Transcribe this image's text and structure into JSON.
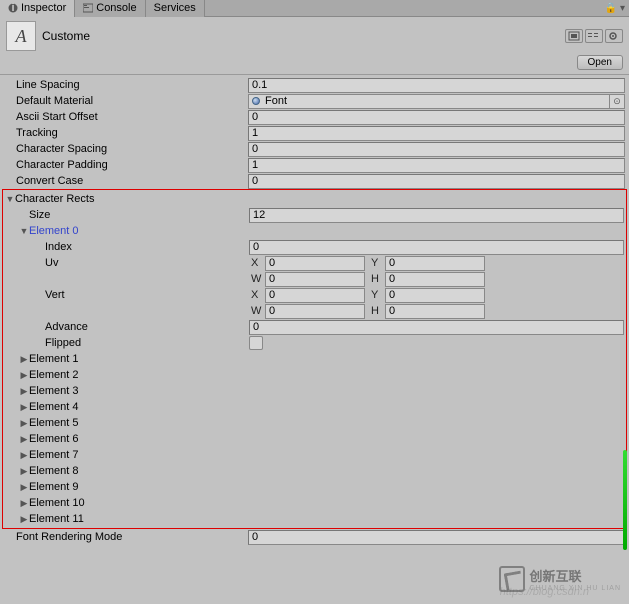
{
  "tabs": {
    "inspector": "Inspector",
    "console": "Console",
    "services": "Services"
  },
  "header": {
    "name": "Custome",
    "open": "Open"
  },
  "props": {
    "line_spacing": {
      "label": "Line Spacing",
      "value": "0.1"
    },
    "default_material": {
      "label": "Default Material",
      "value": "Font"
    },
    "ascii_start_offset": {
      "label": "Ascii Start Offset",
      "value": "0"
    },
    "tracking": {
      "label": "Tracking",
      "value": "1"
    },
    "character_spacing": {
      "label": "Character Spacing",
      "value": "0"
    },
    "character_padding": {
      "label": "Character Padding",
      "value": "1"
    },
    "convert_case": {
      "label": "Convert Case",
      "value": "0"
    }
  },
  "char_rects": {
    "label": "Character Rects",
    "size_label": "Size",
    "size_value": "12",
    "element0": {
      "label": "Element 0",
      "index_label": "Index",
      "index_value": "0",
      "uv_label": "Uv",
      "uv": {
        "x": "0",
        "y": "0",
        "w": "0",
        "h": "0"
      },
      "vert_label": "Vert",
      "vert": {
        "x": "0",
        "y": "0",
        "w": "0",
        "h": "0"
      },
      "advance_label": "Advance",
      "advance_value": "0",
      "flipped_label": "Flipped"
    },
    "elements": [
      "Element 1",
      "Element 2",
      "Element 3",
      "Element 4",
      "Element 5",
      "Element 6",
      "Element 7",
      "Element 8",
      "Element 9",
      "Element 10",
      "Element 11"
    ]
  },
  "font_rendering": {
    "label": "Font Rendering Mode",
    "value": "0"
  },
  "letters": {
    "x": "X",
    "y": "Y",
    "w": "W",
    "h": "H"
  },
  "watermark": {
    "url": "https://blog.csdn.n",
    "brand": "创新互联",
    "sub": "CHUANG XIN HU LIAN"
  }
}
